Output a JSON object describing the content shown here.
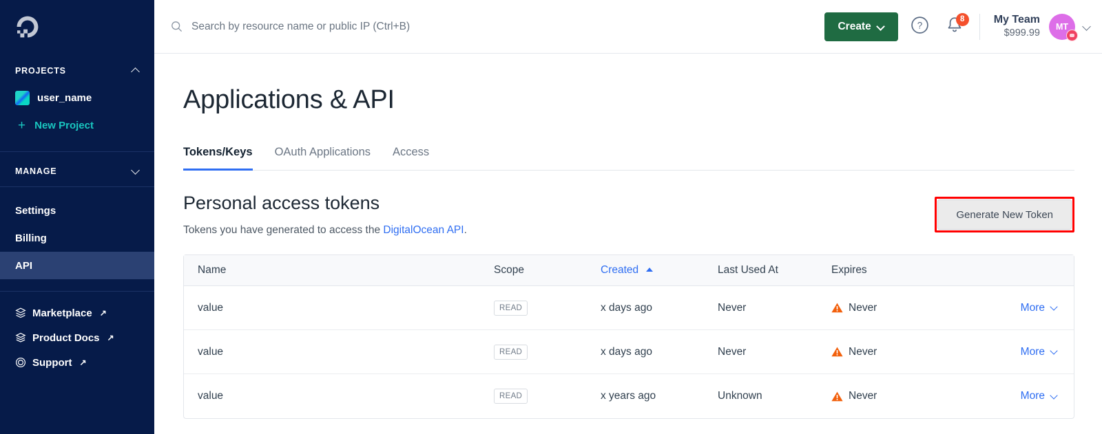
{
  "sidebar": {
    "logo_icon": "digitalocean-logo-icon",
    "projects": {
      "label": "PROJECTS",
      "collapse_icon": "chevron-up-icon",
      "items": [
        {
          "label": "user_name",
          "icon": "project-swatch-icon"
        }
      ],
      "new_project_label": "New Project",
      "new_project_icon": "plus-icon"
    },
    "manage": {
      "label": "MANAGE",
      "collapse_icon": "chevron-down-icon",
      "items": [
        {
          "label": "Settings",
          "active": false
        },
        {
          "label": "Billing",
          "active": false
        },
        {
          "label": "API",
          "active": true
        }
      ]
    },
    "external_links": [
      {
        "label": "Marketplace",
        "icon": "cube-stack-icon",
        "external_icon": "arrow-up-right-icon"
      },
      {
        "label": "Product Docs",
        "icon": "book-stack-icon",
        "external_icon": "arrow-up-right-icon"
      },
      {
        "label": "Support",
        "icon": "lifebuoy-icon",
        "external_icon": "arrow-up-right-icon"
      }
    ]
  },
  "topbar": {
    "search_icon": "search-icon",
    "search_placeholder": "Search by resource name or public IP (Ctrl+B)",
    "search_value": "",
    "create_label": "Create",
    "create_chevron_icon": "chevron-down-icon",
    "help_icon": "question-mark-circle-icon",
    "bell_icon": "bell-icon",
    "bell_badge_count": "8",
    "team_name": "My Team",
    "team_balance": "$999.99",
    "avatar_initials": "MT",
    "avatar_icon": "avatar",
    "user_menu_chevron_icon": "chevron-down-icon"
  },
  "page": {
    "title": "Applications & API",
    "tabs": [
      {
        "label": "Tokens/Keys",
        "active": true
      },
      {
        "label": "OAuth Applications",
        "active": false
      },
      {
        "label": "Access",
        "active": false
      }
    ]
  },
  "tokens_section": {
    "heading": "Personal access tokens",
    "description_prefix": "Tokens you have generated to access the ",
    "description_link": "DigitalOcean API",
    "description_suffix": ".",
    "generate_button_label": "Generate New Token",
    "generate_button_highlight_color": "#ff0000",
    "table": {
      "columns": [
        {
          "label": "Name",
          "sorted": false
        },
        {
          "label": "Scope",
          "sorted": false
        },
        {
          "label": "Created",
          "sorted": true,
          "sort_direction": "asc",
          "sort_icon": "caret-up-icon"
        },
        {
          "label": "Last Used At",
          "sorted": false
        },
        {
          "label": "Expires",
          "sorted": false
        },
        {
          "label": "",
          "sorted": false
        }
      ],
      "rows": [
        {
          "name": "value",
          "scope": "READ",
          "created": "x days ago",
          "last_used_at": "Never",
          "expires": "Never",
          "expires_icon": "warning-triangle-icon",
          "more_label": "More",
          "more_icon": "chevron-down-icon"
        },
        {
          "name": "value",
          "scope": "READ",
          "created": "x days ago",
          "last_used_at": "Never",
          "expires": "Never",
          "expires_icon": "warning-triangle-icon",
          "more_label": "More",
          "more_icon": "chevron-down-icon"
        },
        {
          "name": "value",
          "scope": "READ",
          "created": "x years ago",
          "last_used_at": "Unknown",
          "expires": "Never",
          "expires_icon": "warning-triangle-icon",
          "more_label": "More",
          "more_icon": "chevron-down-icon"
        }
      ]
    }
  },
  "colors": {
    "sidebar_bg": "#061b49",
    "sidebar_active": "#2b4173",
    "accent_teal": "#19c7c0",
    "link_blue": "#2f6ef2",
    "create_green": "#1f6b42",
    "warning_orange": "#f2600c",
    "badge_red": "#f4502c",
    "avatar_magenta": "#dd6ee8"
  }
}
